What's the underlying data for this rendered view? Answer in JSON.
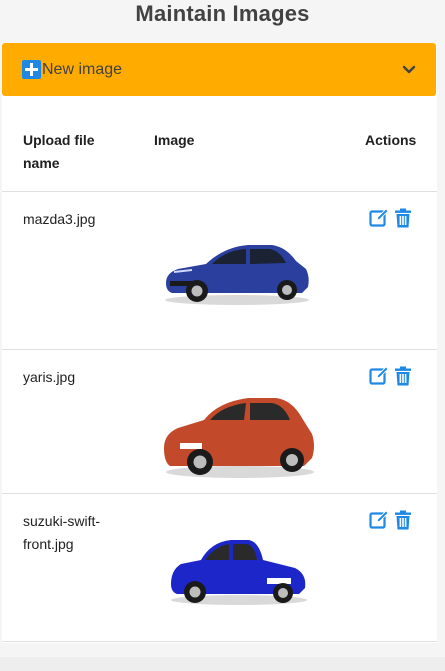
{
  "page": {
    "title": "Maintain Images"
  },
  "new_image_panel": {
    "label": "New image",
    "icon": "plus-square-icon",
    "expand_icon": "chevron-down-icon"
  },
  "table": {
    "headers": {
      "file": "Upload file name",
      "image": "Image",
      "actions": "Actions"
    },
    "rows": [
      {
        "file": "mazda3.jpg",
        "car_color": "#2a3f9e",
        "edit_icon": "edit-icon",
        "delete_icon": "trash-icon"
      },
      {
        "file": "yaris.jpg",
        "car_color": "#c24a2a",
        "edit_icon": "edit-icon",
        "delete_icon": "trash-icon"
      },
      {
        "file": "suzuki-swift-front.jpg",
        "car_color": "#1d26c9",
        "edit_icon": "edit-icon",
        "delete_icon": "trash-icon"
      }
    ]
  },
  "colors": {
    "accent": "#ffab00",
    "action": "#1e88e5"
  }
}
